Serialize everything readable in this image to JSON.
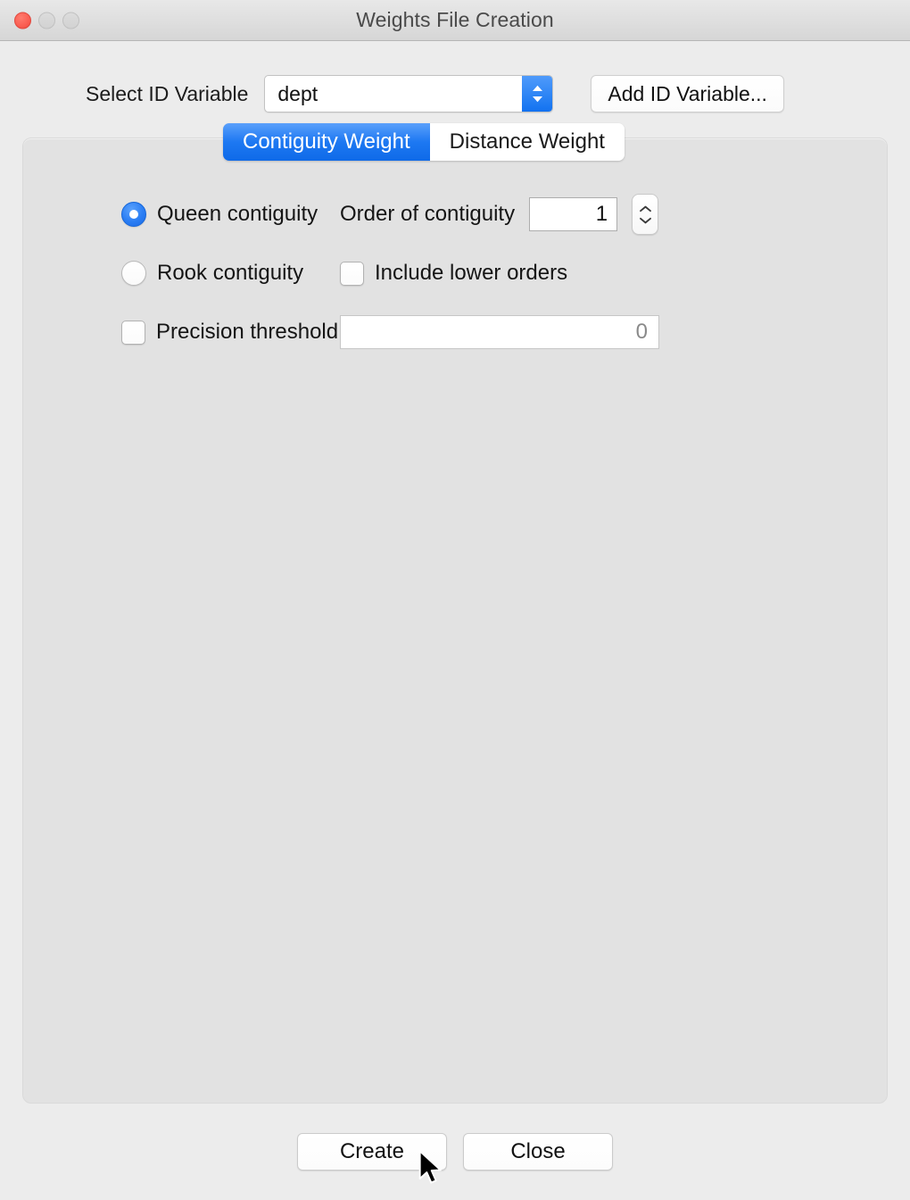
{
  "window": {
    "title": "Weights File Creation",
    "traffic_lights": [
      {
        "name": "close",
        "color": "#fa5e52"
      },
      {
        "name": "minimize",
        "color": "#d6d6d6"
      },
      {
        "name": "zoom",
        "color": "#d6d6d6"
      }
    ]
  },
  "id_variable": {
    "label": "Select ID Variable",
    "selected": "dept",
    "add_button_label": "Add ID Variable..."
  },
  "tabs": [
    {
      "label": "Contiguity Weight",
      "active": true
    },
    {
      "label": "Distance Weight",
      "active": false
    }
  ],
  "contiguity": {
    "queen": {
      "label": "Queen contiguity",
      "selected": true
    },
    "rook": {
      "label": "Rook contiguity",
      "selected": false
    },
    "precision_threshold": {
      "label": "Precision threshold",
      "checked": false
    },
    "order_of_contiguity": {
      "label": "Order of contiguity",
      "value": "1"
    },
    "include_lower_orders": {
      "label": "Include lower orders",
      "checked": false
    },
    "precision_value": "0"
  },
  "footer": {
    "create_label": "Create",
    "close_label": "Close"
  },
  "colors": {
    "accent": "#1d78f2",
    "window_bg": "#ececec",
    "panel_bg": "#e2e2e2",
    "close_light": "#fa5e52"
  }
}
